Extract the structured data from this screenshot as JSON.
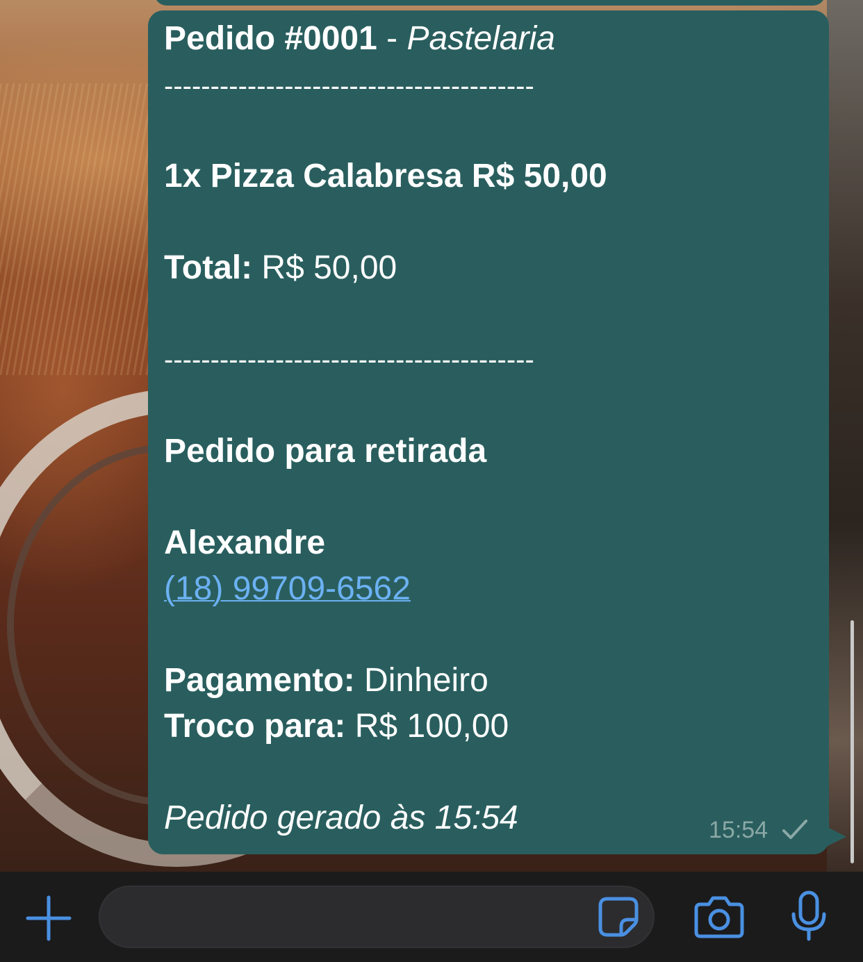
{
  "message": {
    "title_bold": "Pedido #0001",
    "title_sep": " - ",
    "title_italic": "Pastelaria",
    "separator": "----------------------------------------",
    "item": "1x Pizza Calabresa R$ 50,00",
    "total_label": "Total:",
    "total_value": " R$ 50,00",
    "pickup": "Pedido para retirada",
    "customer_name": "Alexandre",
    "phone": "(18) 99709-6562",
    "payment_label": "Pagamento:",
    "payment_value": " Dinheiro",
    "change_label": "Troco para:",
    "change_value": " R$ 100,00",
    "generated": "Pedido gerado às 15:54",
    "time": "15:54",
    "status_icon": "single-check-icon"
  },
  "composer": {
    "input_value": "",
    "icons": [
      "plus-icon",
      "sticker-icon",
      "camera-icon",
      "microphone-icon"
    ],
    "accent_color": "#4a90e2"
  },
  "colors": {
    "bubble": "#2a5e5e",
    "link": "#6cb1f3",
    "bar": "#1b1b1c"
  }
}
